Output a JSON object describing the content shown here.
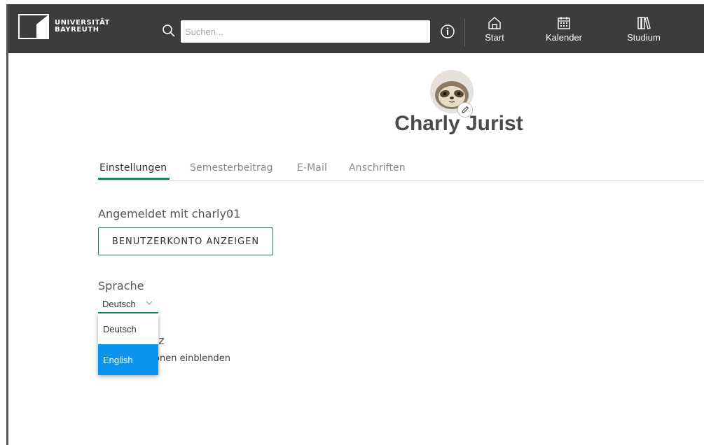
{
  "header": {
    "logo_line1": "UNIVERSITÄT",
    "logo_line2": "BAYREUTH",
    "search_placeholder": "Suchen...",
    "nav": [
      {
        "label": "Start",
        "icon": "home-icon"
      },
      {
        "label": "Kalender",
        "icon": "calendar-icon"
      },
      {
        "label": "Studium",
        "icon": "books-icon"
      }
    ]
  },
  "profile": {
    "name": "Charly Jurist"
  },
  "tabs": [
    {
      "label": "Einstellungen",
      "active": true
    },
    {
      "label": "Semesterbeitrag",
      "active": false
    },
    {
      "label": "E-Mail",
      "active": false
    },
    {
      "label": "Anschriften",
      "active": false
    }
  ],
  "settings": {
    "logged_in_text": "Angemeldet mit charly01",
    "account_button": "BENUTZERKONTO ANZEIGEN",
    "language_label": "Sprache",
    "language_value": "Deutsch",
    "language_options": [
      "Deutsch",
      "English"
    ],
    "language_highlighted": "English",
    "privacy_heading_fragment": "utz",
    "privacy_text_fragment": "onen einblenden"
  },
  "colors": {
    "header_bg": "#3c3c3c",
    "accent_green": "#0e8a5f",
    "dropdown_highlight": "#0b93f0"
  }
}
